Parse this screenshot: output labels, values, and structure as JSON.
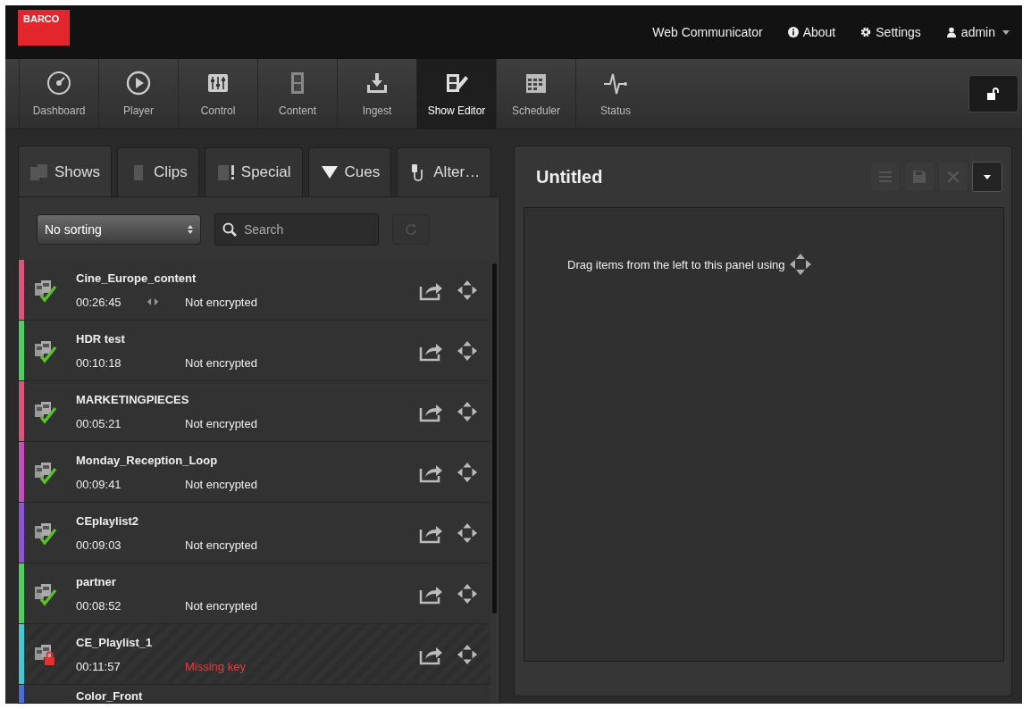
{
  "header": {
    "logo": "BARCO",
    "links": [
      {
        "kind": "plain",
        "label": "Web Communicator"
      },
      {
        "kind": "about",
        "label": "About"
      },
      {
        "kind": "settings",
        "label": "Settings"
      },
      {
        "kind": "user",
        "label": "admin"
      }
    ]
  },
  "nav": [
    {
      "label": "Dashboard",
      "selected": false
    },
    {
      "label": "Player",
      "selected": false
    },
    {
      "label": "Control",
      "selected": false
    },
    {
      "label": "Content",
      "selected": false
    },
    {
      "label": "Ingest",
      "selected": false
    },
    {
      "label": "Show Editor",
      "selected": true
    },
    {
      "label": "Scheduler",
      "selected": false
    },
    {
      "label": "Status",
      "selected": false
    }
  ],
  "library": {
    "tabs": [
      {
        "label": "Shows",
        "selected": true
      },
      {
        "label": "Clips",
        "selected": false
      },
      {
        "label": "Special",
        "selected": false
      },
      {
        "label": "Cues",
        "selected": false
      },
      {
        "label": "Alter…",
        "selected": false
      }
    ],
    "sort": {
      "value": "No sorting"
    },
    "search": {
      "placeholder": "Search"
    },
    "items": [
      {
        "name": "Cine_Europe_content",
        "duration": "00:26:45",
        "arrows": true,
        "status": "Not encrypted",
        "kind": "ok",
        "color": "#d9577f"
      },
      {
        "name": "HDR test",
        "duration": "00:10:18",
        "arrows": false,
        "status": "Not encrypted",
        "kind": "ok",
        "color": "#4cd060"
      },
      {
        "name": "MARKETINGPIECES",
        "duration": "00:05:21",
        "arrows": false,
        "status": "Not encrypted",
        "kind": "ok",
        "color": "#d9577f"
      },
      {
        "name": "Monday_Reception_Loop",
        "duration": "00:09:41",
        "arrows": false,
        "status": "Not encrypted",
        "kind": "ok",
        "color": "#c54fbf"
      },
      {
        "name": "CEplaylist2",
        "duration": "00:09:03",
        "arrows": false,
        "status": "Not encrypted",
        "kind": "ok",
        "color": "#8f55d4"
      },
      {
        "name": "partner",
        "duration": "00:08:52",
        "arrows": false,
        "status": "Not encrypted",
        "kind": "ok",
        "color": "#4cd060"
      },
      {
        "name": "CE_Playlist_1",
        "duration": "00:11:57",
        "arrows": false,
        "status": "Missing key",
        "kind": "locked",
        "color": "#49c6d6"
      },
      {
        "name": "Color_Front",
        "color": "#4a6fd6"
      }
    ]
  },
  "editor": {
    "title": "Untitled",
    "hint": "Drag items from the left to this panel using"
  }
}
